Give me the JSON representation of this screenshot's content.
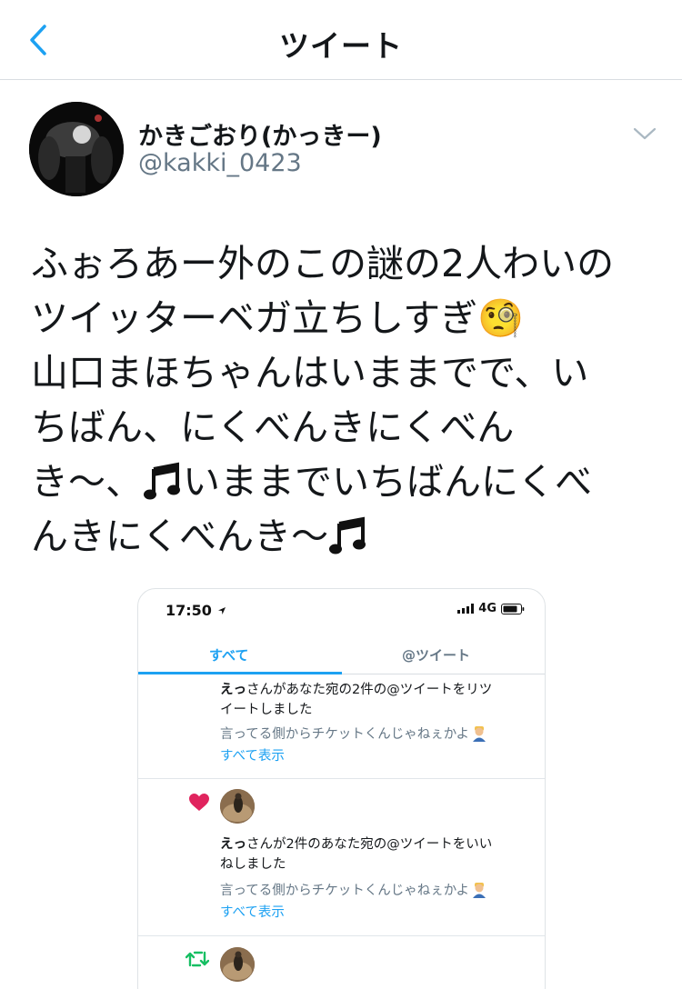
{
  "header": {
    "title": "ツイート"
  },
  "author": {
    "name": "かきごおり(かっきー)",
    "handle": "@kakki_0423"
  },
  "tweet": {
    "lines": [
      "ふぉろあー外のこの謎の2人わいの",
      "ツイッターベガ立ちしすぎ🧐",
      "山口まほちゃんはいままでで、い",
      "ちばん、にくべんきにくべん",
      "き〜、",
      "いままでいちばんにくべ",
      "んきにくべんき〜"
    ]
  },
  "screenshot": {
    "time": "17:50",
    "network": "4G",
    "tabs": {
      "all": "すべて",
      "mentions": "@ツイート"
    },
    "notifications": [
      {
        "user": "えっ",
        "text_line1": "さんがあなた宛の2件の@ツイートをリツ",
        "text_line2": "イートしました",
        "quote": "言ってる側からチケットくんじゃねぇかよ",
        "show_all": "すべて表示"
      },
      {
        "user": "えっ",
        "text_line1": "さんが2件のあなた宛の@ツイートをいい",
        "text_line2": "ねしました",
        "quote": "言ってる側からチケットくんじゃねぇかよ",
        "show_all": "すべて表示"
      }
    ]
  },
  "colors": {
    "accent": "#1da1f2",
    "secondary_text": "#657786",
    "like": "#e0245e",
    "retweet": "#17bf63"
  },
  "icons": [
    "back-chevron-icon",
    "caret-down-icon",
    "location-arrow-icon",
    "signal-icon",
    "battery-icon",
    "heart-icon",
    "retweet-icon",
    "music-note-icon",
    "monocle-face-emoji",
    "man-emoji"
  ]
}
